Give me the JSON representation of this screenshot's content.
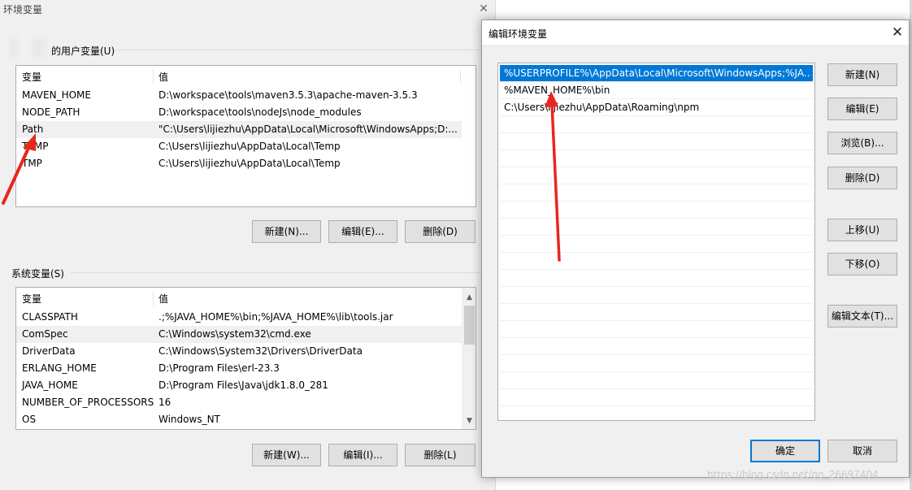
{
  "env_window": {
    "title": "环境变量",
    "user_group_label": "的用户变量(U)",
    "system_group_label": "系统变量(S)",
    "user_vars": {
      "headers": [
        "变量",
        "值"
      ],
      "rows": [
        {
          "name": "MAVEN_HOME",
          "value": "D:\\workspace\\tools\\maven3.5.3\\apache-maven-3.5.3"
        },
        {
          "name": "NODE_PATH",
          "value": "D:\\workspace\\tools\\nodeJs\\node_modules"
        },
        {
          "name": "Path",
          "value": "\"C:\\Users\\lijiezhu\\AppData\\Local\\Microsoft\\WindowsApps;D:..."
        },
        {
          "name": "TEMP",
          "value": "C:\\Users\\lijiezhu\\AppData\\Local\\Temp"
        },
        {
          "name": "TMP",
          "value": "C:\\Users\\lijiezhu\\AppData\\Local\\Temp"
        }
      ],
      "buttons": {
        "new": "新建(N)...",
        "edit": "编辑(E)...",
        "delete": "删除(D)"
      }
    },
    "system_vars": {
      "headers": [
        "变量",
        "值"
      ],
      "rows": [
        {
          "name": "CLASSPATH",
          "value": ".;%JAVA_HOME%\\bin;%JAVA_HOME%\\lib\\tools.jar"
        },
        {
          "name": "ComSpec",
          "value": "C:\\Windows\\system32\\cmd.exe"
        },
        {
          "name": "DriverData",
          "value": "C:\\Windows\\System32\\Drivers\\DriverData"
        },
        {
          "name": "ERLANG_HOME",
          "value": "D:\\Program Files\\erl-23.3"
        },
        {
          "name": "JAVA_HOME",
          "value": "D:\\Program Files\\Java\\jdk1.8.0_281"
        },
        {
          "name": "NUMBER_OF_PROCESSORS",
          "value": "16"
        },
        {
          "name": "OS",
          "value": "Windows_NT"
        }
      ],
      "buttons": {
        "new": "新建(W)...",
        "edit": "编辑(I)...",
        "delete": "删除(L)"
      }
    }
  },
  "edit_dialog": {
    "title": "编辑环境变量",
    "entries": [
      "%USERPROFILE%\\AppData\\Local\\Microsoft\\WindowsApps;%JA...",
      "%MAVEN_HOME%\\bin",
      "C:\\Users\\lijiezhu\\AppData\\Roaming\\npm"
    ],
    "buttons": {
      "new": "新建(N)",
      "edit": "编辑(E)",
      "browse": "浏览(B)...",
      "delete": "删除(D)",
      "move_up": "上移(U)",
      "move_down": "下移(O)",
      "edit_text": "编辑文本(T)...",
      "ok": "确定",
      "cancel": "取消"
    }
  },
  "watermark": "https://blog.csdn.net/qq_26697404",
  "colors": {
    "selection": "#0078d7",
    "annotation_arrow": "#e8271c"
  }
}
